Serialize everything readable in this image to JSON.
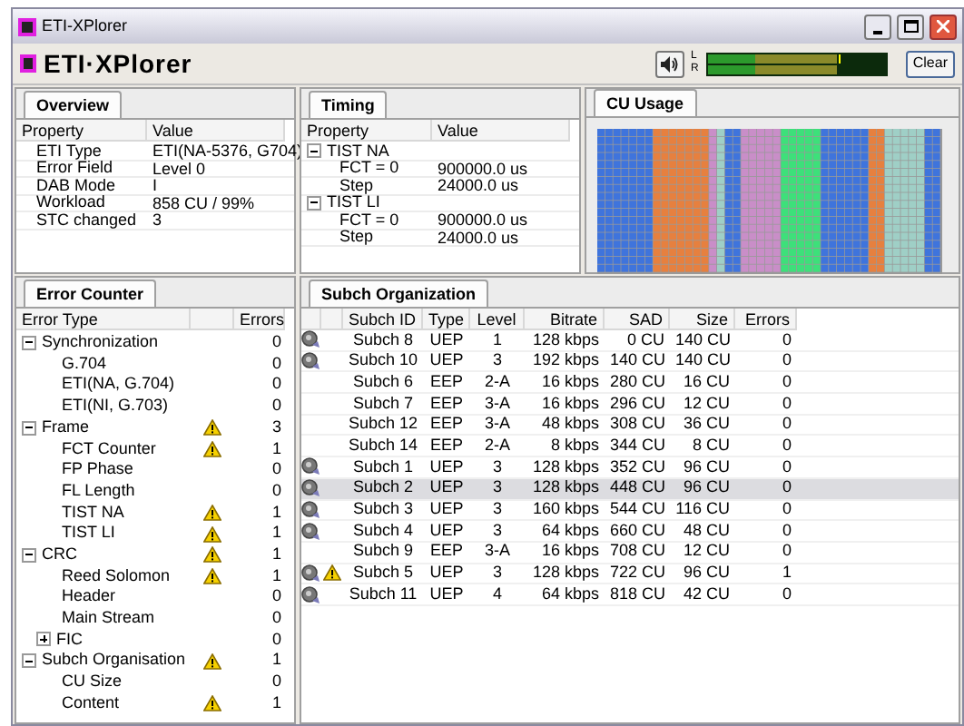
{
  "window": {
    "title": "ETI-XPlorer"
  },
  "toolbar": {
    "logo": "ETI·XPlorer",
    "meter_left": "L",
    "meter_right": "R",
    "clear_button": "Clear"
  },
  "overview": {
    "tab": "Overview",
    "columns": [
      "Property",
      "Value"
    ],
    "rows": [
      {
        "property": "ETI Type",
        "value": "ETI(NA-5376, G704)"
      },
      {
        "property": "Error Field",
        "value": "Level 0"
      },
      {
        "property": "DAB Mode",
        "value": "I"
      },
      {
        "property": "Workload",
        "value": "858 CU / 99%"
      },
      {
        "property": "STC changed",
        "value": "3"
      }
    ]
  },
  "timing": {
    "tab": "Timing",
    "columns": [
      "Property",
      "Value"
    ],
    "rows": [
      {
        "property": "TIST NA",
        "expanded": true,
        "children": [
          {
            "property": "FCT = 0",
            "value": "900000.0 us"
          },
          {
            "property": "Step",
            "value": "24000.0 us"
          }
        ]
      },
      {
        "property": "TIST LI",
        "expanded": true,
        "children": [
          {
            "property": "FCT = 0",
            "value": "900000.0 us"
          },
          {
            "property": "Step",
            "value": "24000.0 us"
          }
        ]
      }
    ]
  },
  "cu_usage": {
    "tab": "CU Usage"
  },
  "error_counter": {
    "tab": "Error Counter",
    "columns": [
      "Error Type",
      "Errors"
    ],
    "rows": [
      {
        "name": "Synchronization",
        "errors": "0",
        "warning": false,
        "expanded": true,
        "children": [
          {
            "name": "G.704",
            "errors": "0",
            "warning": false
          },
          {
            "name": "ETI(NA, G.704)",
            "errors": "0",
            "warning": false
          },
          {
            "name": "ETI(NI, G.703)",
            "errors": "0",
            "warning": false
          }
        ]
      },
      {
        "name": "Frame",
        "errors": "3",
        "warning": true,
        "expanded": true,
        "children": [
          {
            "name": "FCT Counter",
            "errors": "1",
            "warning": true
          },
          {
            "name": "FP Phase",
            "errors": "0",
            "warning": false
          },
          {
            "name": "FL Length",
            "errors": "0",
            "warning": false
          },
          {
            "name": "TIST NA",
            "errors": "1",
            "warning": true
          },
          {
            "name": "TIST LI",
            "errors": "1",
            "warning": true
          }
        ]
      },
      {
        "name": "CRC",
        "errors": "1",
        "warning": true,
        "expanded": true,
        "children": [
          {
            "name": "Reed Solomon",
            "errors": "1",
            "warning": true
          },
          {
            "name": "Header",
            "errors": "0",
            "warning": false
          },
          {
            "name": "Main Stream",
            "errors": "0",
            "warning": false
          },
          {
            "name": "FIC",
            "errors": "0",
            "warning": false,
            "expanded": false
          }
        ]
      },
      {
        "name": "Subch Organisation",
        "errors": "1",
        "warning": true,
        "expanded": true,
        "children": [
          {
            "name": "CU Size",
            "errors": "0",
            "warning": false
          },
          {
            "name": "Content",
            "errors": "1",
            "warning": true
          }
        ]
      }
    ]
  },
  "subch": {
    "tab": "Subch Organization",
    "columns": [
      "Subch ID",
      "Type",
      "Level",
      "Bitrate",
      "SAD",
      "Size",
      "Errors"
    ],
    "rows": [
      {
        "audio": true,
        "warning": false,
        "selected": false,
        "cells": [
          "Subch 8",
          "UEP",
          "1",
          "128 kbps",
          "0 CU",
          "140 CU",
          "0"
        ]
      },
      {
        "audio": true,
        "warning": false,
        "selected": false,
        "cells": [
          "Subch 10",
          "UEP",
          "3",
          "192 kbps",
          "140 CU",
          "140 CU",
          "0"
        ]
      },
      {
        "audio": false,
        "warning": false,
        "selected": false,
        "cells": [
          "Subch 6",
          "EEP",
          "2-A",
          "16 kbps",
          "280 CU",
          "16 CU",
          "0"
        ]
      },
      {
        "audio": false,
        "warning": false,
        "selected": false,
        "cells": [
          "Subch 7",
          "EEP",
          "3-A",
          "16 kbps",
          "296 CU",
          "12 CU",
          "0"
        ]
      },
      {
        "audio": false,
        "warning": false,
        "selected": false,
        "cells": [
          "Subch 12",
          "EEP",
          "3-A",
          "48 kbps",
          "308 CU",
          "36 CU",
          "0"
        ]
      },
      {
        "audio": false,
        "warning": false,
        "selected": false,
        "cells": [
          "Subch 14",
          "EEP",
          "2-A",
          "8 kbps",
          "344 CU",
          "8 CU",
          "0"
        ]
      },
      {
        "audio": true,
        "warning": false,
        "selected": false,
        "cells": [
          "Subch 1",
          "UEP",
          "3",
          "128 kbps",
          "352 CU",
          "96 CU",
          "0"
        ]
      },
      {
        "audio": true,
        "warning": false,
        "selected": true,
        "cells": [
          "Subch 2",
          "UEP",
          "3",
          "128 kbps",
          "448 CU",
          "96 CU",
          "0"
        ]
      },
      {
        "audio": true,
        "warning": false,
        "selected": false,
        "cells": [
          "Subch 3",
          "UEP",
          "3",
          "160 kbps",
          "544 CU",
          "116 CU",
          "0"
        ]
      },
      {
        "audio": true,
        "warning": false,
        "selected": false,
        "cells": [
          "Subch 4",
          "UEP",
          "3",
          "64 kbps",
          "660 CU",
          "48 CU",
          "0"
        ]
      },
      {
        "audio": false,
        "warning": false,
        "selected": false,
        "cells": [
          "Subch 9",
          "EEP",
          "3-A",
          "16 kbps",
          "708 CU",
          "12 CU",
          "0"
        ]
      },
      {
        "audio": true,
        "warning": true,
        "selected": false,
        "cells": [
          "Subch 5",
          "UEP",
          "3",
          "128 kbps",
          "722 CU",
          "96 CU",
          "1"
        ]
      },
      {
        "audio": true,
        "warning": false,
        "selected": false,
        "cells": [
          "Subch 11",
          "UEP",
          "4",
          "64 kbps",
          "818 CU",
          "42 CU",
          "0"
        ]
      }
    ]
  }
}
